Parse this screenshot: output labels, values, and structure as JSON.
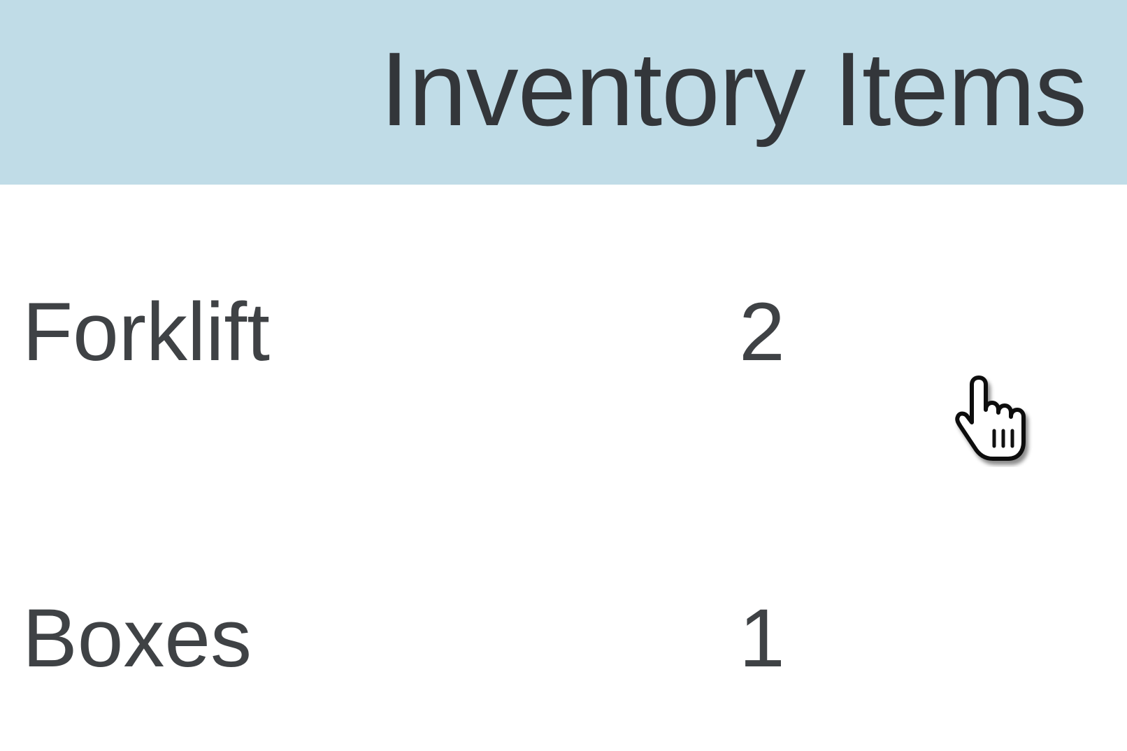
{
  "header": {
    "title": "Inventory Items",
    "background_color": "#c0dce7"
  },
  "items": [
    {
      "name": "Forklift",
      "quantity": "2"
    },
    {
      "name": "Boxes",
      "quantity": "1"
    }
  ],
  "cursor": {
    "icon": "hand-pointer-icon"
  }
}
